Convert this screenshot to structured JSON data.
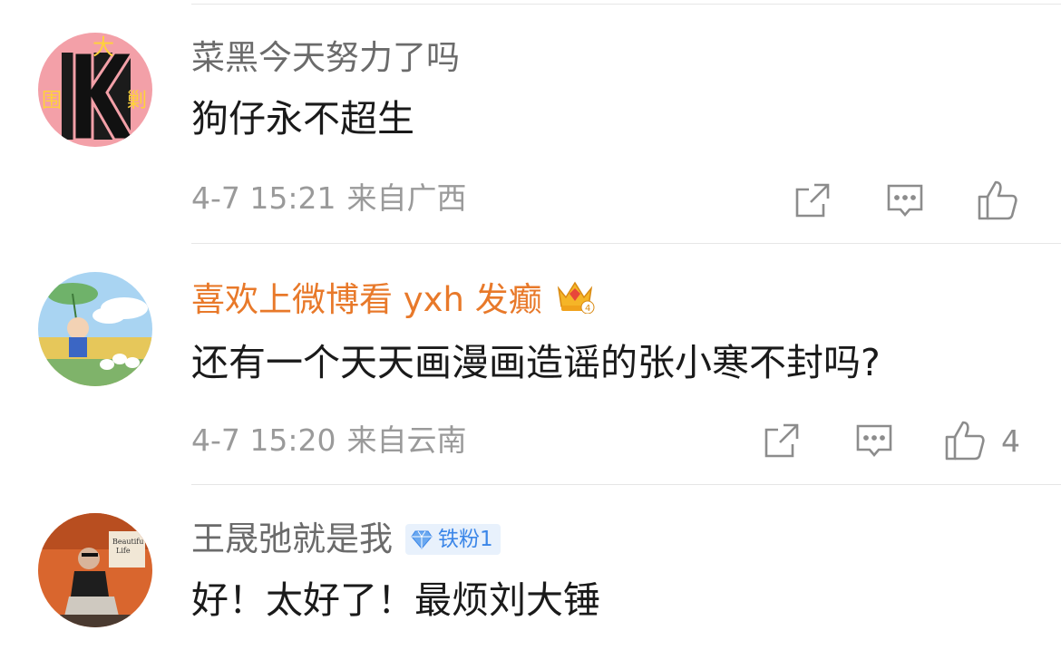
{
  "comments": [
    {
      "username": "菜黑今天努力了吗",
      "text": "狗仔永不超生",
      "time": "4-7 15:21",
      "location": "来自广西",
      "likes": "",
      "avatar_glyphs": [
        "大",
        "围",
        "剿"
      ]
    },
    {
      "username": "喜欢上微博看 yxh 发癫",
      "text": "还有一个天天画漫画造谣的张小寒不封吗?",
      "time": "4-7 15:20",
      "location": "来自云南",
      "likes": "4",
      "crown_level": "4"
    },
    {
      "username": "王晟弛就是我",
      "text": "好！太好了！最烦刘大锤",
      "badge": "铁粉1",
      "avatar_text": [
        "Beautifu",
        "Life"
      ]
    }
  ],
  "icons": [
    "forward-icon",
    "comment-icon",
    "like-icon",
    "crown-badge-icon",
    "diamond-icon"
  ],
  "colors": {
    "vip_name": "#e8792a",
    "username": "#6b6b6b",
    "meta": "#9a9a9a",
    "fan_badge": "#3b86e8"
  }
}
